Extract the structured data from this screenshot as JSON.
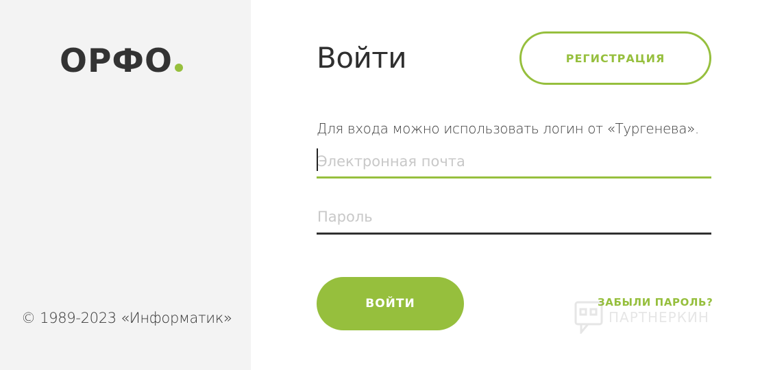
{
  "brand": {
    "logo_text": "ОРФО",
    "accent_color": "#96bf3d"
  },
  "sidebar": {
    "copyright": "© 1989-2023 «Информатик»"
  },
  "form": {
    "title": "Войти",
    "register_label": "РЕГИСТРАЦИЯ",
    "hint": "Для входа можно использовать логин от «Тургенева».",
    "email": {
      "value": "",
      "placeholder": "Электронная почта"
    },
    "password": {
      "value": "",
      "placeholder": "Пароль"
    },
    "login_label": "ВОЙТИ",
    "forgot_label": "ЗАБЫЛИ ПАРОЛЬ?"
  },
  "watermark": {
    "text": "ПАРТНЕРКИН",
    "icon": "chat-bubble-icon"
  }
}
